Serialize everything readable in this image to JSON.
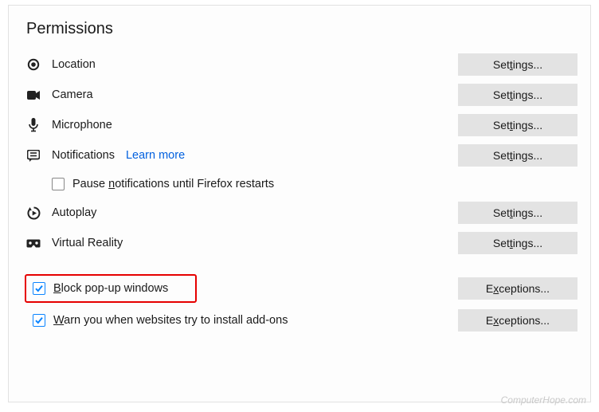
{
  "title": "Permissions",
  "buttons": {
    "settings": "Settings...",
    "exceptions": "Exceptions..."
  },
  "items": {
    "location": {
      "label": "Location"
    },
    "camera": {
      "label": "Camera"
    },
    "microphone": {
      "label": "Microphone"
    },
    "notifications": {
      "label": "Notifications",
      "learn_more": "Learn more",
      "pause_pre": "Pause ",
      "pause_key": "n",
      "pause_post": "otifications until Firefox restarts"
    },
    "autoplay": {
      "label": "Autoplay"
    },
    "vr": {
      "label": "Virtual Reality"
    },
    "popup": {
      "pre": "",
      "key": "B",
      "post": "lock pop-up windows"
    },
    "addons": {
      "pre": "",
      "key": "W",
      "post": "arn you when websites try to install add-ons"
    }
  },
  "exceptions": {
    "pre": "E",
    "key": "x",
    "post": "ceptions..."
  },
  "settings_btn": {
    "pre": "Set",
    "key": "t",
    "post": "ings..."
  },
  "watermark": "ComputerHope.com"
}
